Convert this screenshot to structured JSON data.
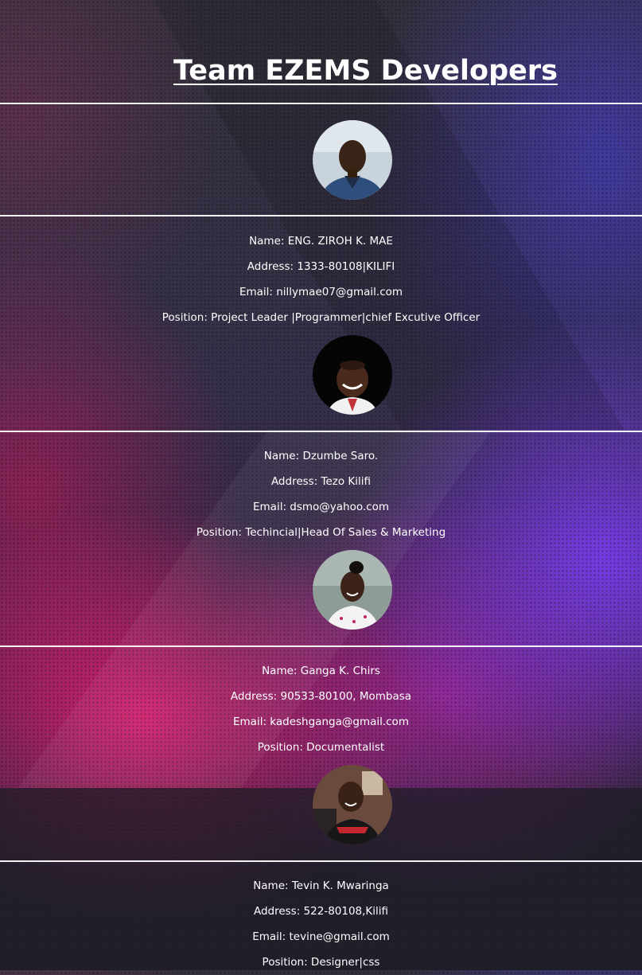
{
  "page": {
    "title": "Team EZEMS Developers"
  },
  "members": [
    {
      "name": "Name: ENG. ZIROH K. MAE",
      "address": "Address: 1333-80108|KILIFI",
      "email": "Email: nillymae07@gmail.com",
      "position": "Position: Project Leader |Programmer|chief Excutive Officer",
      "photo": "member-photo-icon"
    },
    {
      "name": "Name: Dzumbe Saro.",
      "address": "Address: Tezo Kilifi",
      "email": "Email: dsmo@yahoo.com",
      "position": "Position: Techincial|Head Of Sales & Marketing",
      "photo": "member-photo-icon"
    },
    {
      "name": "Name: Ganga K. Chirs",
      "address": "Address: 90533-80100, Mombasa",
      "email": "Email: kadeshganga@gmail.com",
      "position": "Position: Documentalist",
      "photo": "member-photo-icon"
    },
    {
      "name": "Name: Tevin K. Mwaringa",
      "address": "Address: 522-80108,Kilifi",
      "email": "Email: tevine@gmail.com",
      "position": "Position: Designer|css",
      "photo": "member-photo-icon"
    }
  ],
  "colors": {
    "text": "#ffffff",
    "rule": "#f2f2f2",
    "accent_pink": "#ec2076",
    "accent_purple": "#7a3ceb"
  }
}
